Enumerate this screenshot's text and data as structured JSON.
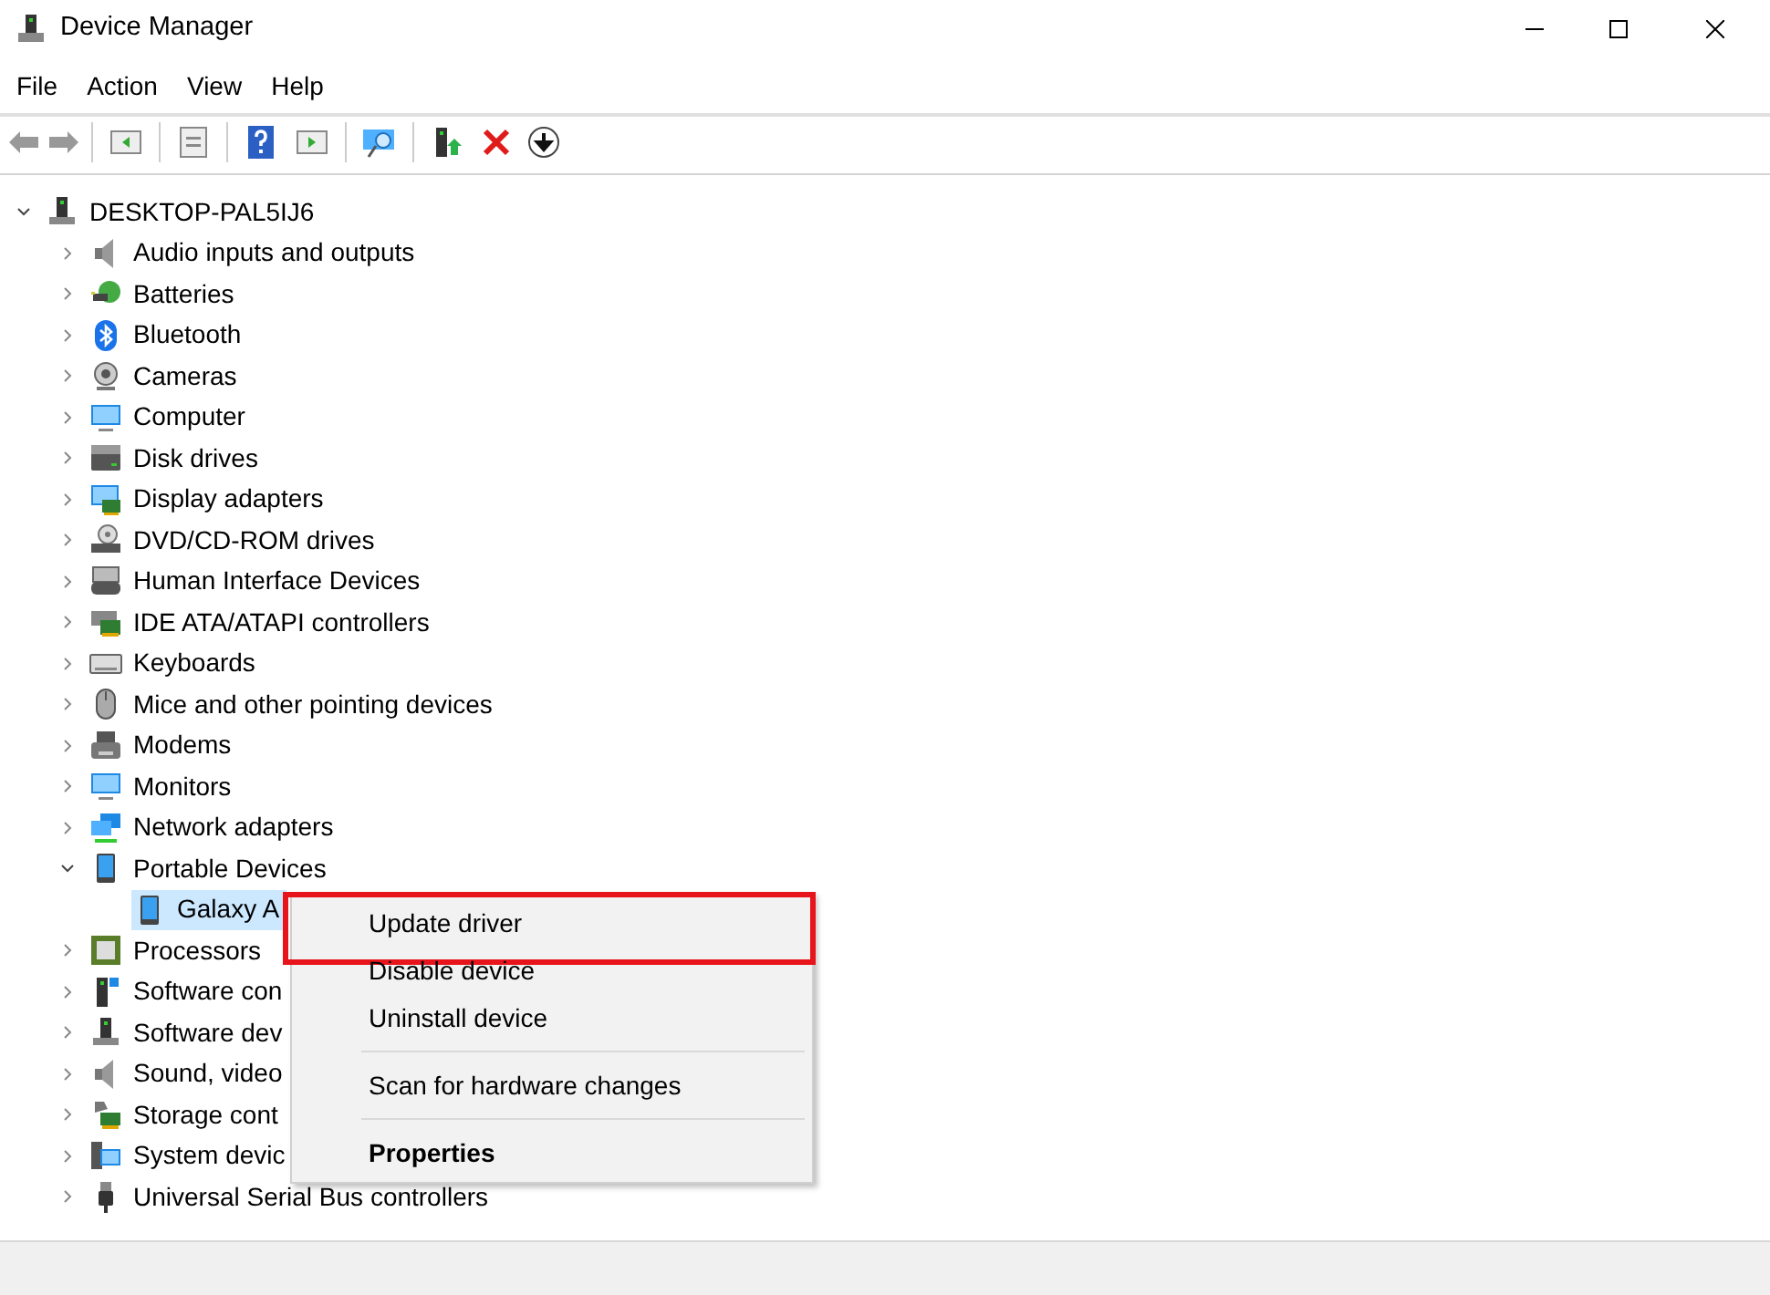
{
  "window": {
    "title": "Device Manager"
  },
  "menu_bar": [
    "File",
    "Action",
    "View",
    "Help"
  ],
  "tree": {
    "label": "DESKTOP-PAL5IJ6",
    "expanded": true,
    "selected": false,
    "children": [
      {
        "label": "Audio inputs and outputs",
        "expanded": false,
        "selected": false
      },
      {
        "label": "Batteries",
        "expanded": false,
        "selected": false
      },
      {
        "label": "Bluetooth",
        "expanded": false,
        "selected": false
      },
      {
        "label": "Cameras",
        "expanded": false,
        "selected": false
      },
      {
        "label": "Computer",
        "expanded": false,
        "selected": false
      },
      {
        "label": "Disk drives",
        "expanded": false,
        "selected": false
      },
      {
        "label": "Display adapters",
        "expanded": false,
        "selected": false
      },
      {
        "label": "DVD/CD-ROM drives",
        "expanded": false,
        "selected": false
      },
      {
        "label": "Human Interface Devices",
        "expanded": false,
        "selected": false
      },
      {
        "label": "IDE ATA/ATAPI controllers",
        "expanded": false,
        "selected": false
      },
      {
        "label": "Keyboards",
        "expanded": false,
        "selected": false
      },
      {
        "label": "Mice and other pointing devices",
        "expanded": false,
        "selected": false
      },
      {
        "label": "Modems",
        "expanded": false,
        "selected": false
      },
      {
        "label": "Monitors",
        "expanded": false,
        "selected": false
      },
      {
        "label": "Network adapters",
        "expanded": false,
        "selected": false
      },
      {
        "label": "Portable Devices",
        "expanded": true,
        "selected": false,
        "children": [
          {
            "label": "Galaxy A",
            "selected": true
          }
        ]
      },
      {
        "label": "Processors",
        "expanded": false,
        "selected": false
      },
      {
        "label": "Software con",
        "expanded": false,
        "selected": false
      },
      {
        "label": "Software dev",
        "expanded": false,
        "selected": false
      },
      {
        "label": "Sound, video",
        "expanded": false,
        "selected": false
      },
      {
        "label": "Storage cont",
        "expanded": false,
        "selected": false
      },
      {
        "label": "System devic",
        "expanded": false,
        "selected": false
      },
      {
        "label": "Universal Serial Bus controllers",
        "expanded": false,
        "selected": false
      }
    ]
  },
  "context_menu": [
    {
      "kind": "item",
      "label": "Update driver",
      "default": false,
      "highlighted": true
    },
    {
      "kind": "item",
      "label": "Disable device",
      "default": false,
      "highlighted": false
    },
    {
      "kind": "item",
      "label": "Uninstall device",
      "default": false,
      "highlighted": false
    },
    {
      "kind": "separator"
    },
    {
      "kind": "item",
      "label": "Scan for hardware changes",
      "default": false,
      "highlighted": false
    },
    {
      "kind": "separator"
    },
    {
      "kind": "item",
      "label": "Properties",
      "default": true,
      "highlighted": false
    }
  ]
}
